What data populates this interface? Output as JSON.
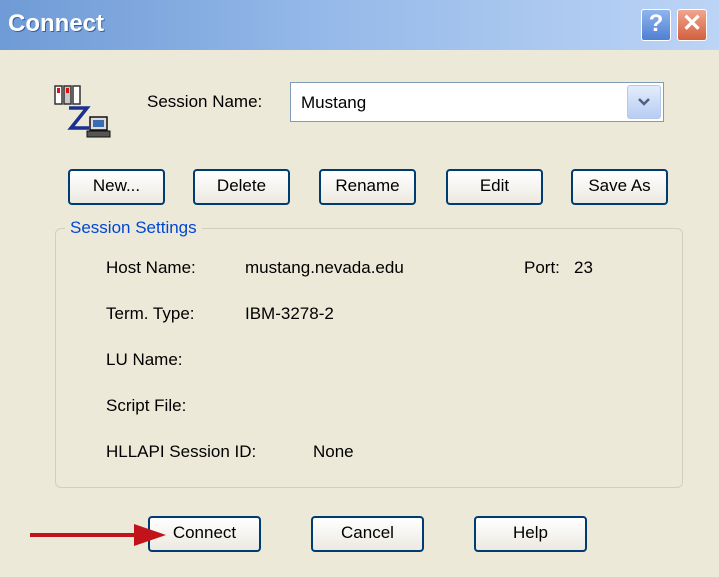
{
  "window": {
    "title": "Connect"
  },
  "titlebar": {
    "help_label": "?",
    "close_label": "✕"
  },
  "session": {
    "label": "Session Name:",
    "value": "Mustang"
  },
  "actions": {
    "new": "New...",
    "delete": "Delete",
    "rename": "Rename",
    "edit": "Edit",
    "save_as": "Save As"
  },
  "settings": {
    "title": "Session Settings",
    "host_label": "Host Name:",
    "host_value": "mustang.nevada.edu",
    "port_label": "Port:",
    "port_value": "23",
    "term_label": "Term. Type:",
    "term_value": "IBM-3278-2",
    "lu_label": "LU Name:",
    "script_label": "Script File:",
    "hllapi_label": "HLLAPI Session ID:",
    "hllapi_value": "None"
  },
  "footer": {
    "connect": "Connect",
    "cancel": "Cancel",
    "help": "Help"
  },
  "icons": {
    "app": "terminal-session-icon",
    "arrow": "red-arrow-annotation",
    "dropdown": "chevron-down-icon"
  },
  "colors": {
    "titlebar": "#6f9bd6",
    "group_title": "#0046d5",
    "arrow": "#c0141a",
    "dialog_bg": "#ece9d8"
  }
}
